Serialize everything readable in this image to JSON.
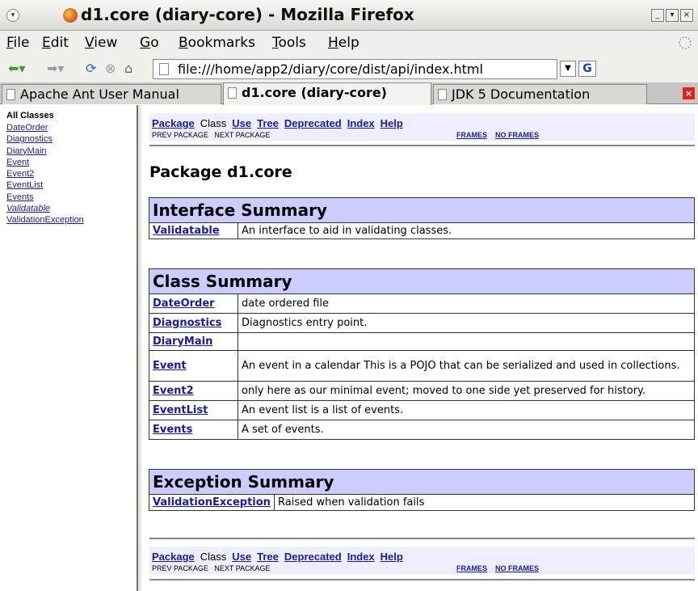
{
  "window": {
    "title": "d1.core (diary-core) - Mozilla Firefox",
    "menu_glyph": "▾",
    "buttons": [
      "_",
      "▾",
      "×"
    ]
  },
  "menubar": {
    "items": [
      {
        "label": "File",
        "key": "F",
        "rest": "ile"
      },
      {
        "label": "Edit",
        "key": "E",
        "rest": "dit"
      },
      {
        "label": "View",
        "key": "V",
        "rest": "iew"
      },
      {
        "label": "Go",
        "key": "G",
        "rest": "o"
      },
      {
        "label": "Bookmarks",
        "key": "B",
        "rest": "ookmarks"
      },
      {
        "label": "Tools",
        "key": "T",
        "rest": "ools"
      },
      {
        "label": "Help",
        "key": "H",
        "rest": "elp"
      }
    ]
  },
  "navbar": {
    "url": "file:///home/app2/diary/core/dist/api/index.html",
    "icons": [
      "back-icon",
      "forward-icon",
      "reload-icon",
      "stop-icon",
      "home-icon"
    ],
    "google_glyph": "G"
  },
  "tabs": [
    {
      "label": "Apache Ant User Manual",
      "active": false
    },
    {
      "label": "d1.core (diary-core)",
      "active": true
    },
    {
      "label": "JDK 5 Documentation",
      "active": false
    }
  ],
  "sidebar": {
    "title": "All Classes",
    "classes": [
      {
        "label": "DateOrder",
        "italic": false
      },
      {
        "label": "Diagnostics",
        "italic": false
      },
      {
        "label": "DiaryMain",
        "italic": false
      },
      {
        "label": "Event",
        "italic": false
      },
      {
        "label": "Event2",
        "italic": false
      },
      {
        "label": "EventList",
        "italic": false
      },
      {
        "label": "Events",
        "italic": false
      },
      {
        "label": "Validatable",
        "italic": true
      },
      {
        "label": "ValidationException",
        "italic": false
      }
    ]
  },
  "nav": {
    "package": "Package",
    "class": "Class",
    "use": "Use",
    "tree": "Tree",
    "deprecated": "Deprecated",
    "index": "Index",
    "help": "Help",
    "prev": "PREV PACKAGE",
    "next": "NEXT PACKAGE",
    "frames": "FRAMES",
    "no_frames": "NO FRAMES"
  },
  "page": {
    "title": "Package d1.core"
  },
  "interface_summary": {
    "heading": "Interface Summary",
    "rows": [
      {
        "name": "Validatable",
        "desc": "An interface to aid in validating classes."
      }
    ]
  },
  "class_summary": {
    "heading": "Class Summary",
    "rows": [
      {
        "name": "DateOrder",
        "desc": "date ordered file"
      },
      {
        "name": "Diagnostics",
        "desc": "Diagnostics entry point."
      },
      {
        "name": "DiaryMain",
        "desc": ""
      },
      {
        "name": "Event",
        "desc": "An event in a calendar This is a POJO that can be serialized and used in collections."
      },
      {
        "name": "Event2",
        "desc": "only here as our minimal event; moved to one side yet preserved for history."
      },
      {
        "name": "EventList",
        "desc": "An event list is a list of events."
      },
      {
        "name": "Events",
        "desc": "A set of events."
      }
    ]
  },
  "exception_summary": {
    "heading": "Exception Summary",
    "rows": [
      {
        "name": "ValidationException",
        "desc": "Raised when validation fails"
      }
    ]
  },
  "colors": {
    "link": "#1a1aa6",
    "table_header": "#ccccff",
    "nav_strip": "#eeeeff"
  }
}
